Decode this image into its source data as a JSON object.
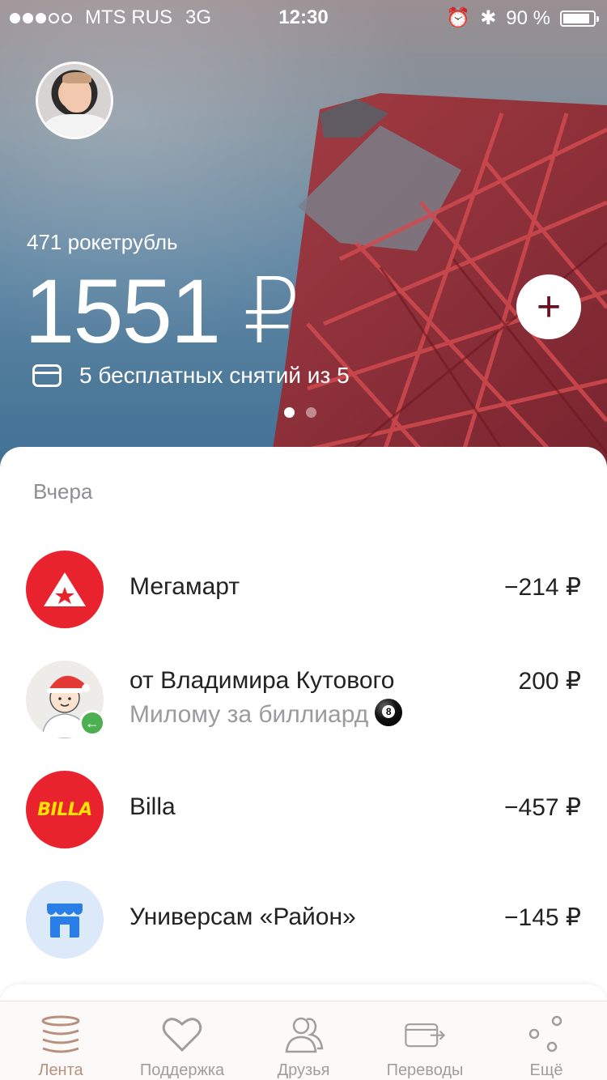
{
  "status": {
    "carrier": "MTS RUS",
    "network": "3G",
    "time": "12:30",
    "battery": "90 %",
    "battery_level": 0.9,
    "signal_bars_filled": 3,
    "signal_bars_total": 5
  },
  "account": {
    "bonus": "471 рокетрубль",
    "balance": "1551 ₽",
    "withdrawals": "5 бесплатных снятий из 5",
    "add_label": "+"
  },
  "pager": {
    "pages": 2,
    "active": 1
  },
  "feed": {
    "date": "Вчера",
    "transactions": [
      {
        "name": "Мегамарт",
        "amount": "−214 ₽"
      },
      {
        "name": "от Владимира Кутового",
        "subtitle": "Милому за биллиард",
        "amount": "200 ₽"
      },
      {
        "name": "Billa",
        "logo_text": "BILLA",
        "amount": "−457 ₽"
      },
      {
        "name": "Универсам «Район»",
        "amount": "−145 ₽"
      }
    ]
  },
  "tabs": [
    {
      "label": "Лента",
      "icon": "feed-stack-icon",
      "active": true
    },
    {
      "label": "Поддержка",
      "icon": "heart-icon",
      "active": false
    },
    {
      "label": "Друзья",
      "icon": "friends-icon",
      "active": false
    },
    {
      "label": "Переводы",
      "icon": "transfer-card-icon",
      "active": false
    },
    {
      "label": "Ещё",
      "icon": "more-dots-icon",
      "active": false
    }
  ],
  "colors": {
    "accent_tab": "#b8917e",
    "add_plus": "#6a0f1f",
    "brand_red": "#e8232d",
    "billa_yellow": "#ffe300",
    "shop_bg": "#dbe9f8",
    "incoming_green": "#4caf50"
  }
}
